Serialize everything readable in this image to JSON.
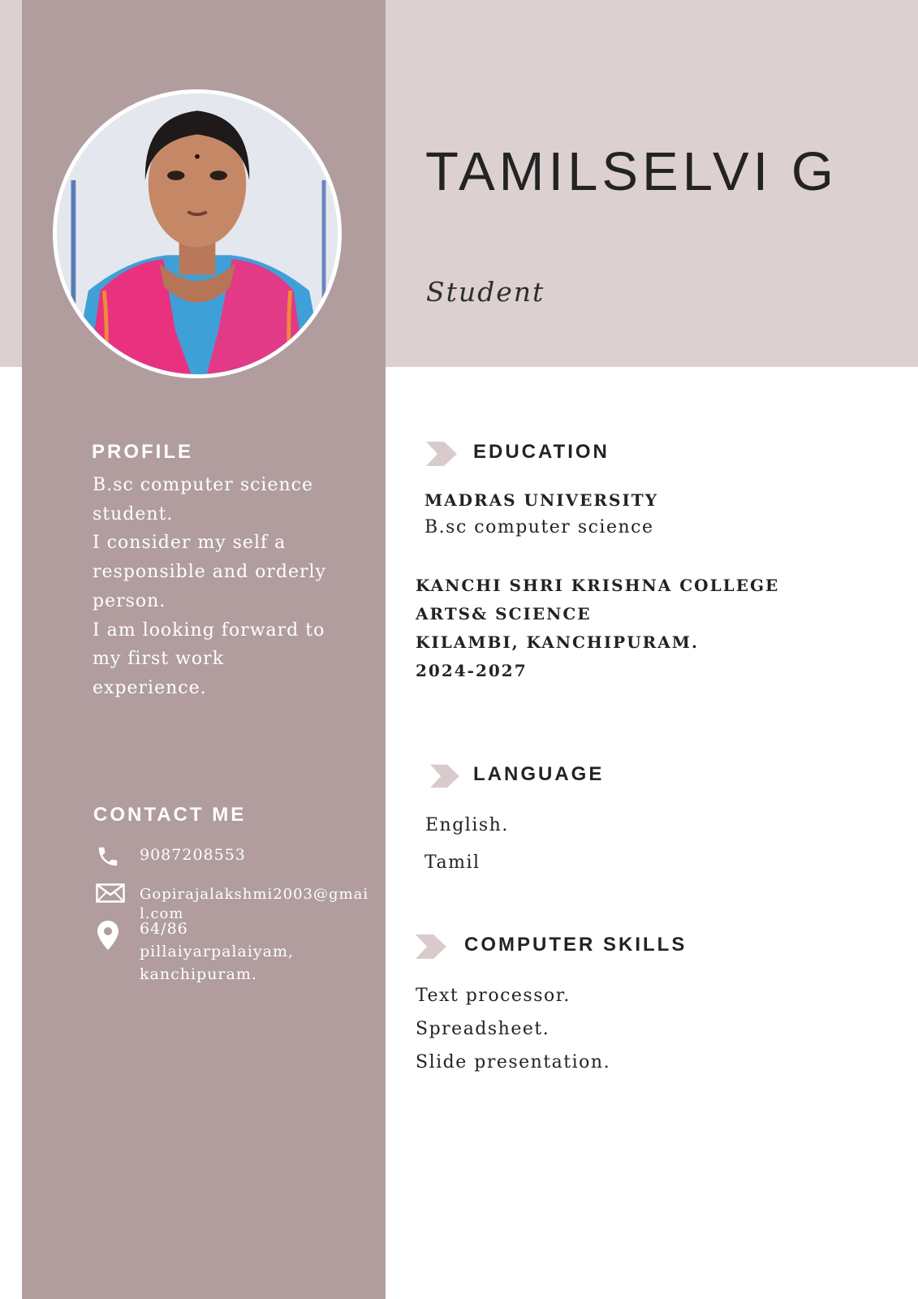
{
  "header": {
    "name": "TAMILSELVI G",
    "role": "Student"
  },
  "profile": {
    "heading": "PROFILE",
    "text": "B.sc computer science\nstudent.\nI consider my self a\nresponsible and orderly\nperson.\nI am looking forward to\nmy first work\nexperience."
  },
  "contact": {
    "heading": "CONTACT ME",
    "phone": "9087208553",
    "email": "Gopirajalakshmi2003@gmai\nl.com",
    "address": "64/86\npillaiyarpalaiyam,\nkanchipuram."
  },
  "education": {
    "heading": "EDUCATION",
    "university": "MADRAS UNIVERSITY",
    "degree": "B.sc computer science",
    "college": "KANCHI SHRI KRISHNA COLLEGE\nARTS& SCIENCE\nKILAMBI, KANCHIPURAM.\n2024-2027"
  },
  "language": {
    "heading": "LANGUAGE",
    "items": [
      "English.",
      "Tamil"
    ]
  },
  "skills": {
    "heading": "COMPUTER SKILLS",
    "items": [
      "Text processor.",
      "Spreadsheet.",
      "Slide presentation."
    ]
  },
  "colors": {
    "sidebar": "#b19d9e",
    "top_band": "#dcd0d1",
    "text_dark": "#232323",
    "arrow": "#d9cbcc"
  },
  "icons": [
    "phone-icon",
    "mail-icon",
    "location-pin-icon",
    "chevron-arrow-icon"
  ]
}
